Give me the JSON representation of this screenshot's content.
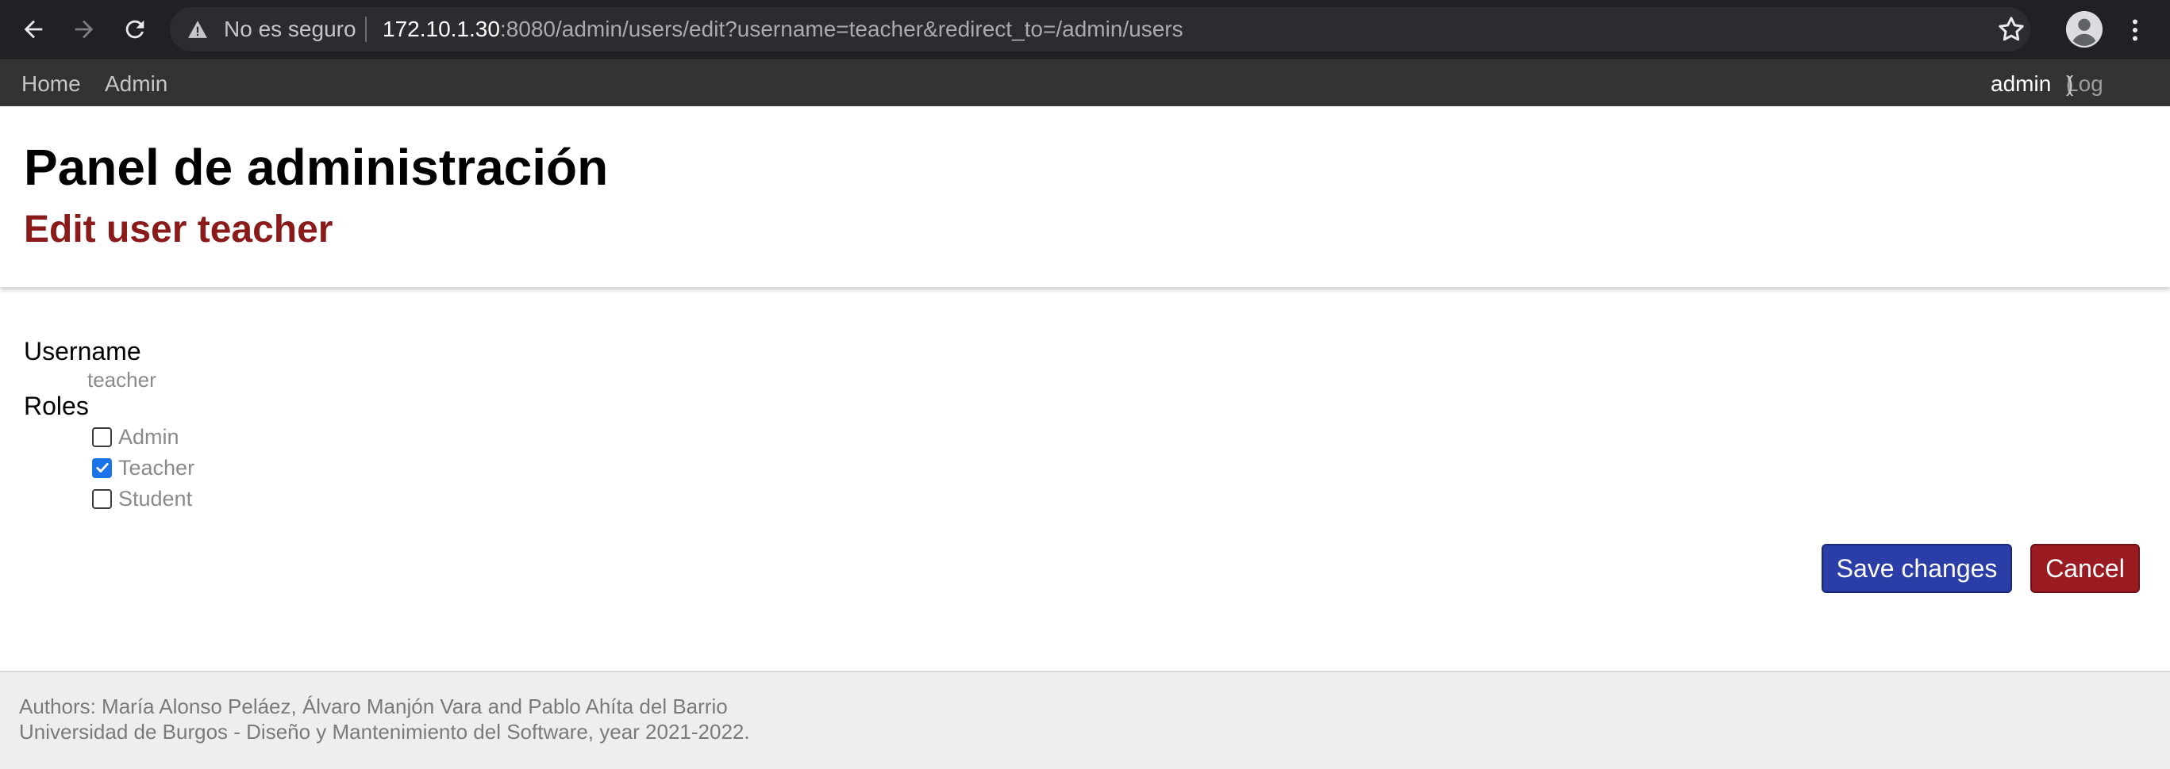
{
  "browser": {
    "security_label": "No es seguro",
    "url_host": "172.10.1.30",
    "url_rest": ":8080/admin/users/edit?username=teacher&redirect_to=/admin/users",
    "icons": [
      "back-icon",
      "forward-icon",
      "reload-icon",
      "warning-icon",
      "star-icon",
      "profile-icon",
      "more-icon"
    ]
  },
  "nav": {
    "home": "Home",
    "admin": "Admin",
    "user": "admin",
    "logout_open": "(",
    "logout": "Log out",
    "logout_close": ")"
  },
  "header": {
    "title": "Panel de administración",
    "subtitle": "Edit user teacher"
  },
  "form": {
    "username_label": "Username",
    "username_value": "teacher",
    "roles_label": "Roles",
    "roles": [
      {
        "label": "Admin",
        "checked": false
      },
      {
        "label": "Teacher",
        "checked": true
      },
      {
        "label": "Student",
        "checked": false
      }
    ],
    "save_label": "Save changes",
    "cancel_label": "Cancel"
  },
  "footer": {
    "line1": "Authors: María Alonso Peláez, Álvaro Manjón Vara and Pablo Ahíta del Barrio",
    "line2": "Universidad de Burgos - Diseño y Mantenimiento del Software, year 2021-2022."
  },
  "colors": {
    "nav_bg": "#333333",
    "subtitle": "#8b1a1a",
    "save_button": "#2b3ea8",
    "cancel_button": "#9b1b22",
    "checkbox_checked": "#1a73e8"
  }
}
